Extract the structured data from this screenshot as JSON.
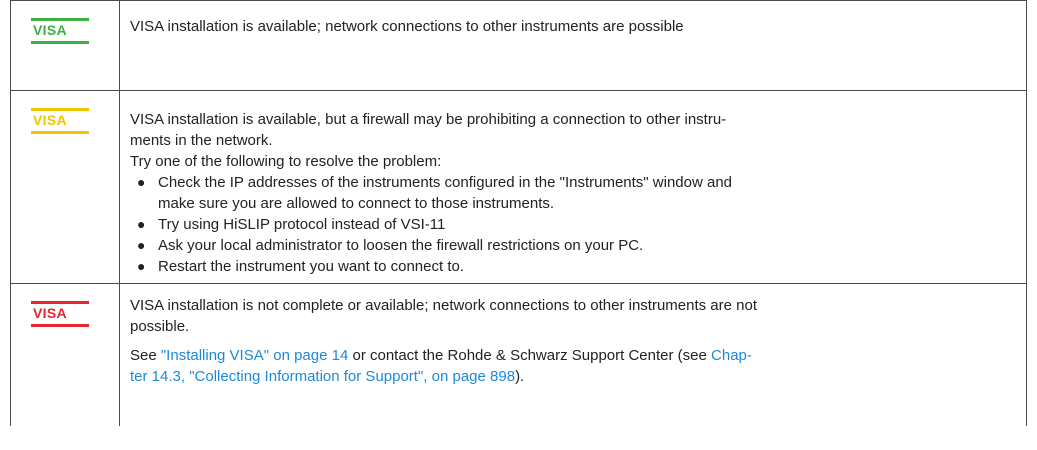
{
  "badge_label": "VISA",
  "colors": {
    "green": "#3cb043",
    "yellow": "#f5c400",
    "red": "#e0282d",
    "link": "#1c8ad8"
  },
  "rows": [
    {
      "status": "green",
      "text": "VISA installation is available; network connections to other instruments are possible"
    },
    {
      "status": "yellow",
      "line1": "VISA installation is available, but a firewall may be prohibiting a connection to other instru-",
      "line2": "ments in the network.",
      "intro": "Try one of the following to resolve the problem:",
      "bullets": [
        {
          "line1": "Check the IP addresses of the instruments configured in the \"Instruments\" window and",
          "line2": "make sure you are allowed to connect to those instruments."
        },
        {
          "line1": "Try using HiSLIP protocol instead of VSI-11"
        },
        {
          "line1": "Ask your local administrator to loosen the firewall restrictions on your PC."
        },
        {
          "line1": "Restart the instrument you want to connect to."
        }
      ]
    },
    {
      "status": "red",
      "line1": "VISA installation is not complete or available; network connections to other instruments are not",
      "line2": "possible.",
      "see_prefix": "See ",
      "link1": "\"Installing VISA\" on page 14",
      "see_mid": " or contact the Rohde & Schwarz Support Center (see ",
      "link2_part1": "Chap-",
      "link2_part2": "ter 14.3, \"Collecting Information for Support\", on page 898",
      "see_suffix": ")."
    }
  ]
}
